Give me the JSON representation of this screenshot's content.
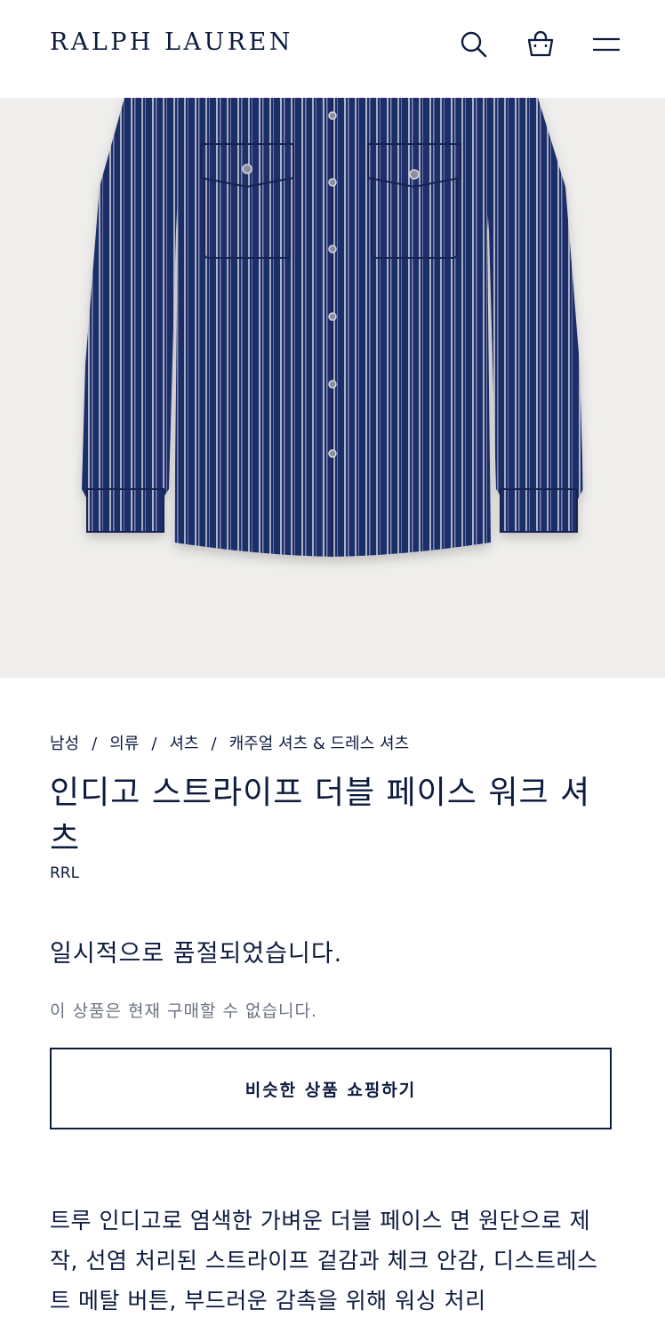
{
  "header": {
    "logo": "RALPH LAUREN",
    "icons": [
      "search-icon",
      "shopping-bag-icon",
      "menu-icon"
    ]
  },
  "hero": {
    "image_alt": "indigo striped double-face work shirt",
    "colors": {
      "background": "#efeeec",
      "shirt": "#1e2f6b",
      "stripe": "#c9cbd6"
    }
  },
  "breadcrumb": {
    "items": [
      "남성",
      "의류",
      "셔츠",
      "캐주얼 셔츠 & 드레스 셔츠"
    ],
    "separator": "/"
  },
  "product": {
    "title": "인디고 스트라이프 더블 페이스 워크 셔츠",
    "brand": "RRL"
  },
  "availability": {
    "status": "일시적으로 품절되었습니다.",
    "message": "이 상품은 현재 구매할 수 없습니다.",
    "button_label": "비슷한 상품 쇼핑하기"
  },
  "description": "트루 인디고로 염색한 가벼운 더블 페이스 면 원단으로 제작, 선염 처리된 스트라이프 겉감과 체크 안감, 디스트레스트 메탈 버튼, 부드러운 감촉을 위해 워싱 처리",
  "colors": {
    "navy": "#0d1b3e",
    "muted_text": "#6b7280"
  }
}
